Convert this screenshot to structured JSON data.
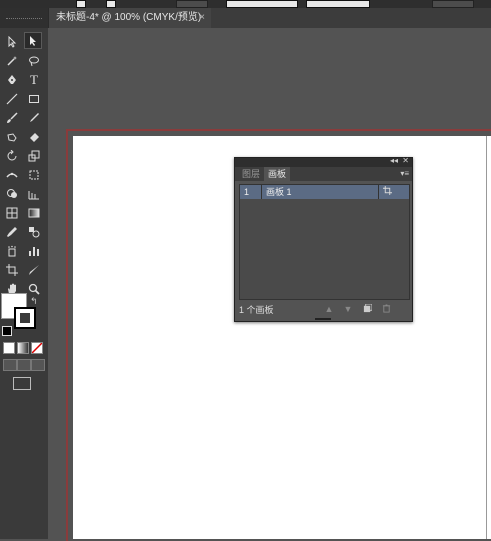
{
  "document_tab": {
    "title": "未标题-4* @ 100% (CMYK/预览)",
    "close_glyph": "×"
  },
  "artboards_panel": {
    "tabs": [
      {
        "label": "图层",
        "active": false
      },
      {
        "label": "画板",
        "active": true
      }
    ],
    "collapse_glyph": "◂◂",
    "close_glyph": "✕",
    "menu_glyph": "▾≡",
    "artboards": [
      {
        "number": "1",
        "name": "画板 1"
      }
    ],
    "footer_count": "1 个画板"
  },
  "colors": {
    "fill": "#ffffff",
    "stroke": "#000000",
    "artboard_border": "#8a3b3b",
    "selected_row": "#5b6b84"
  },
  "tools": [
    "selection-tool",
    "direct-selection-tool",
    "magic-wand-tool",
    "lasso-tool",
    "pen-tool",
    "type-tool",
    "line-segment-tool",
    "rectangle-tool",
    "paintbrush-tool",
    "pencil-tool",
    "blob-brush-tool",
    "eraser-tool",
    "rotate-tool",
    "scale-tool",
    "width-tool",
    "free-transform-tool",
    "shape-builder-tool",
    "perspective-grid-tool",
    "mesh-tool",
    "gradient-tool",
    "eyedropper-tool",
    "blend-tool",
    "symbol-sprayer-tool",
    "column-graph-tool",
    "artboard-tool",
    "slice-tool",
    "hand-tool",
    "zoom-tool"
  ]
}
